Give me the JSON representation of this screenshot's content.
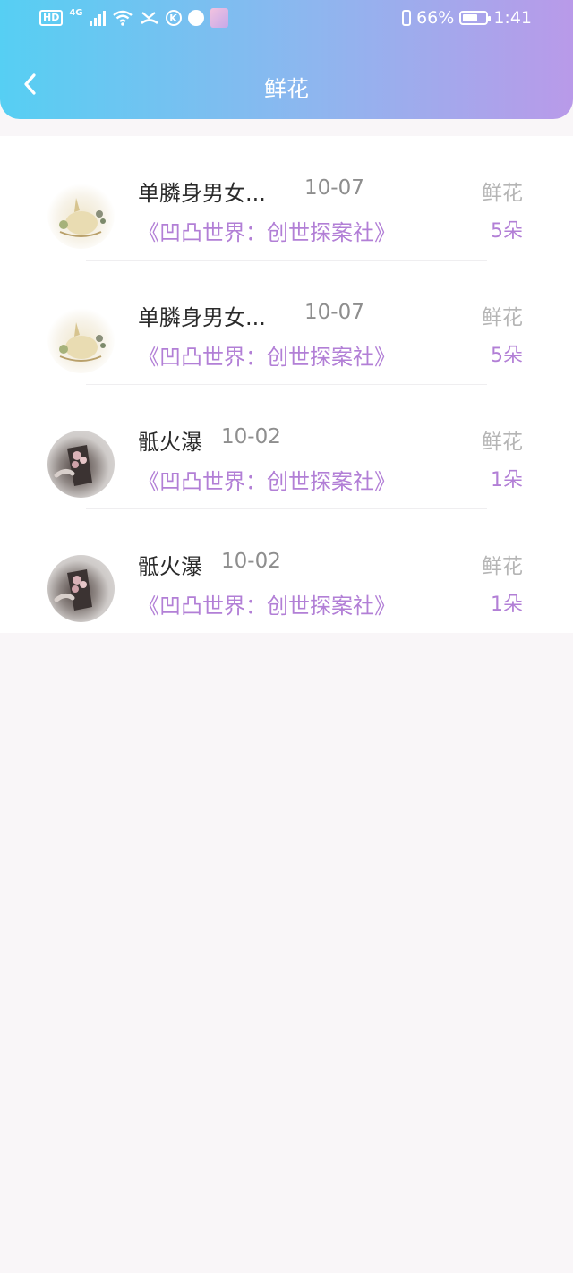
{
  "status_bar": {
    "hd": "HD",
    "network": "4G",
    "battery": "66%",
    "time": "1:41",
    "icons": [
      "hd-icon",
      "signal-icon",
      "wifi-icon",
      "missed-call-icon",
      "k-app-icon",
      "ball-app-icon",
      "anime-app-icon",
      "vibrate-icon",
      "battery-icon"
    ]
  },
  "header": {
    "title": "鲜花",
    "back_icon": "chevron-left-icon"
  },
  "colors": {
    "accent": "#b27fd6",
    "header_start": "#56cff3",
    "header_end": "#b99ae9"
  },
  "records": [
    {
      "name": "单膦身男女...",
      "date": "10-07",
      "book": "《凹凸世界：创世探案社》",
      "type": "鲜花",
      "count": "5朵",
      "avatar": "cat-illustration"
    },
    {
      "name": "单膦身男女...",
      "date": "10-07",
      "book": "《凹凸世界：创世探案社》",
      "type": "鲜花",
      "count": "5朵",
      "avatar": "cat-illustration"
    },
    {
      "name": "骶火瀑",
      "date": "10-02",
      "book": "《凹凸世界：创世探案社》",
      "type": "鲜花",
      "count": "1朵",
      "avatar": "flower-photo"
    },
    {
      "name": "骶火瀑",
      "date": "10-02",
      "book": "《凹凸世界：创世探案社》",
      "type": "鲜花",
      "count": "1朵",
      "avatar": "flower-photo"
    }
  ]
}
